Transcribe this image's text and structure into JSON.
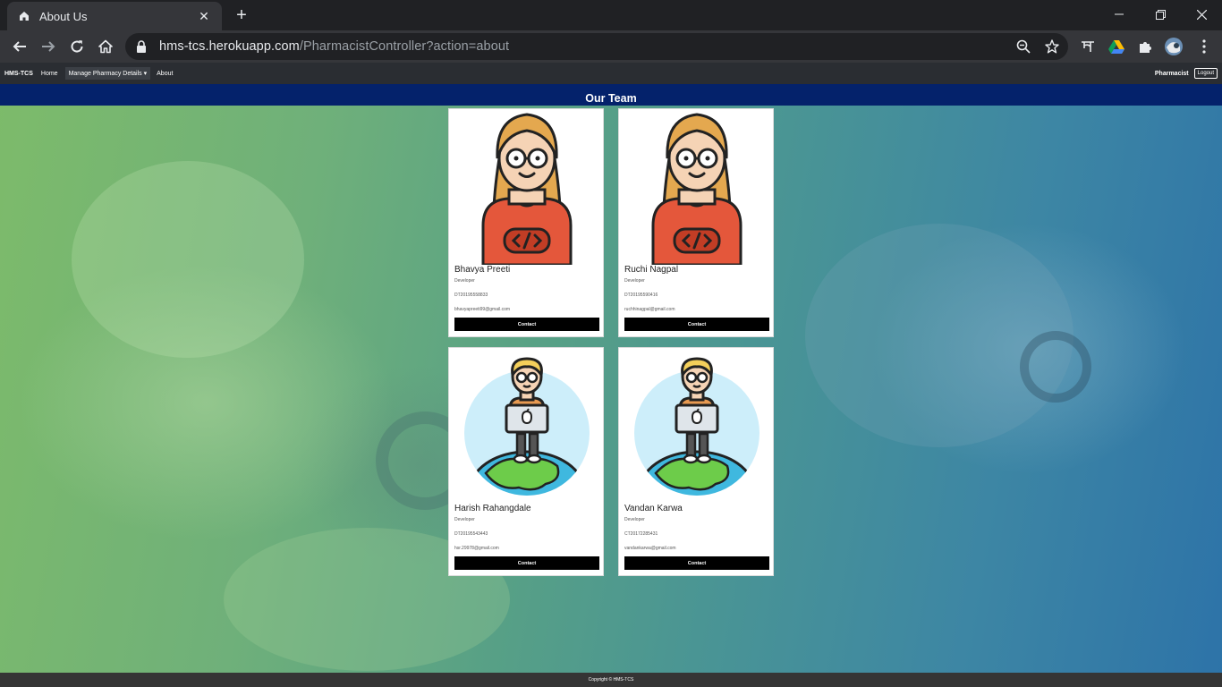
{
  "browser": {
    "tab_title": "About Us",
    "url_host": "hms-tcs.herokuapp.com",
    "url_path": "/PharmacistController?action=about"
  },
  "app_nav": {
    "brand": "HMS-TCS",
    "links": [
      "Home",
      "Manage Pharmacy Details",
      "About"
    ],
    "dropdown_caret": "▾",
    "user": "Pharmacist",
    "logout": "Logout"
  },
  "section_title": "Our Team",
  "team": [
    {
      "name": "Bhavya Preeti",
      "role": "Developer",
      "id": "DT20195558833",
      "email": "bhavyapreeti99@gmail.com",
      "button": "Contact",
      "avatar": "female-developer-icon"
    },
    {
      "name": "Ruchi Nagpal",
      "role": "Developer",
      "id": "DT20195590416",
      "email": "ruchhinagpal@gmail.com",
      "button": "Contact",
      "avatar": "female-developer-icon"
    },
    {
      "name": "Harish Rahangdale",
      "role": "Developer",
      "id": "DT20195543443",
      "email": "hsr.29978@gmail.com",
      "button": "Contact",
      "avatar": "developer-on-globe-icon"
    },
    {
      "name": "Vandan Karwa",
      "role": "Developer",
      "id": "CT20172285431",
      "email": "vandankarwa@gmail.com",
      "button": "Contact",
      "avatar": "developer-on-globe-icon"
    }
  ],
  "footer": "Copyright © HMS-TCS",
  "colors": {
    "team_bar": "#04226b",
    "nav_bar": "#2a2d32",
    "contact_button": "#000000",
    "footer": "#353535"
  }
}
